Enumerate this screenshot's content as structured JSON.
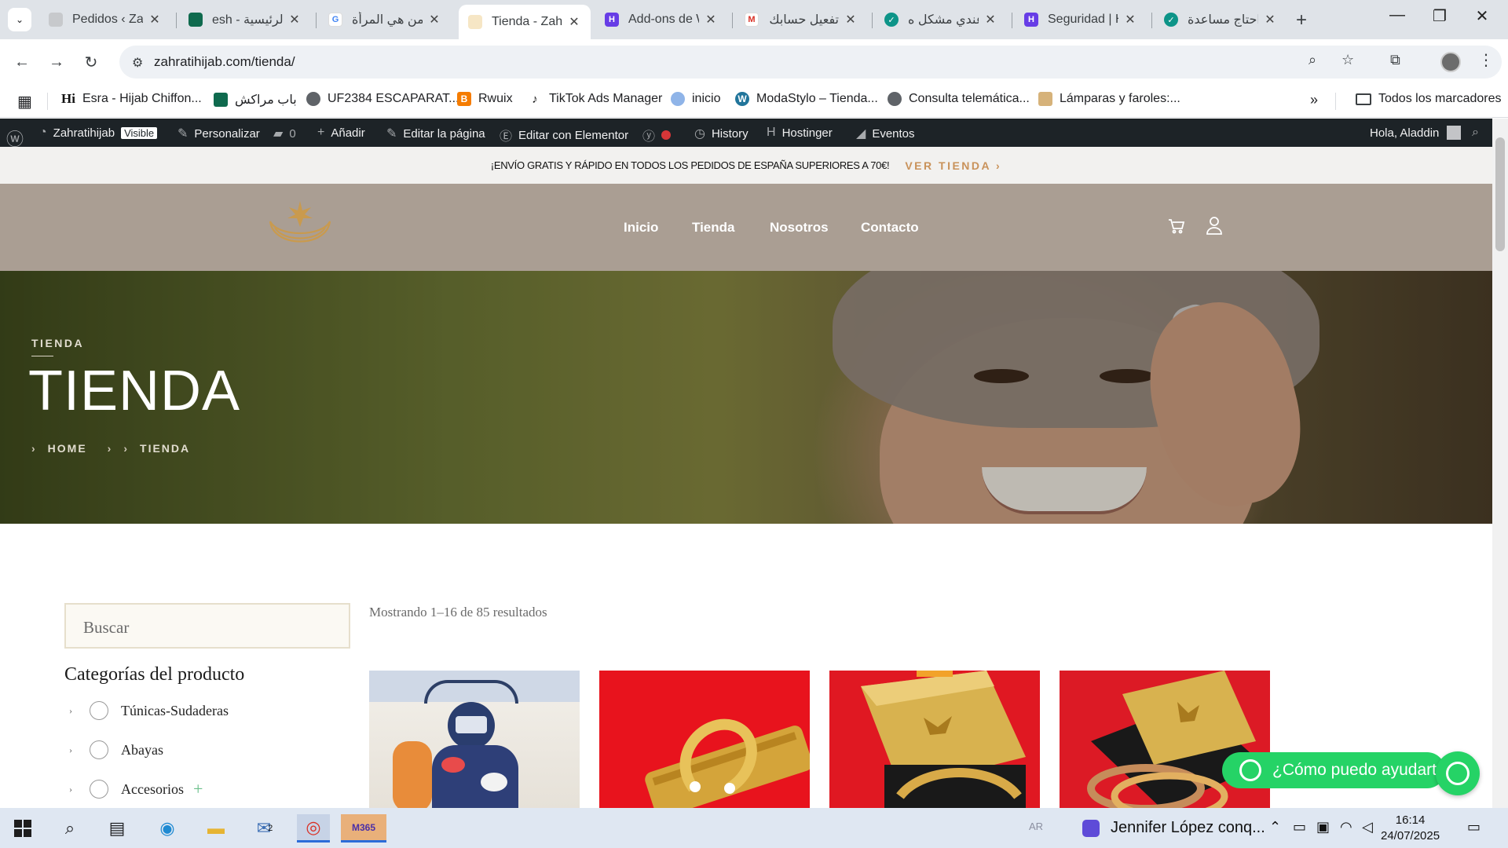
{
  "browser": {
    "tabs": [
      {
        "title": "Pedidos ‹ Zah",
        "icon": "wordpress-icon",
        "active": false
      },
      {
        "title": "esh - الرئيسية",
        "icon": "site-icon",
        "active": false
      },
      {
        "title": "من هي المرأة",
        "icon": "google-icon",
        "active": false
      },
      {
        "title": "Tienda - Zahr",
        "icon": "site-icon",
        "active": true
      },
      {
        "title": "Add-ons de W",
        "icon": "hostinger-icon",
        "active": false
      },
      {
        "title": "تفعيل حسابك",
        "icon": "gmail-icon",
        "active": false
      },
      {
        "title": "عندي مشكل ه",
        "icon": "support-icon",
        "active": false
      },
      {
        "title": "Seguridad | H",
        "icon": "hostinger-icon",
        "active": false
      },
      {
        "title": "احتاج مساعدة",
        "icon": "support-icon",
        "active": false
      }
    ],
    "url": "zahratihijab.com/tienda/",
    "bookmarks": [
      {
        "label": "Esra - Hijab Chiffon...",
        "icon": "hi-icon"
      },
      {
        "label": "باب مراكش",
        "icon": "site-icon"
      },
      {
        "label": "UF2384 ESCAPARAT...",
        "icon": "globe-icon"
      },
      {
        "label": "Rwuix",
        "icon": "blogger-icon"
      },
      {
        "label": "TikTok Ads Manager",
        "icon": "tiktok-icon"
      },
      {
        "label": "inicio",
        "icon": "cloud-icon"
      },
      {
        "label": "ModaStylo – Tienda...",
        "icon": "wordpress-icon"
      },
      {
        "label": "Consulta telemática...",
        "icon": "globe-icon"
      },
      {
        "label": "Lámparas y faroles:...",
        "icon": "lamp-icon"
      }
    ],
    "all_bookmarks_label": "Todos los marcadores"
  },
  "adminbar": {
    "site_name": "Zahratihijab",
    "visible_badge": "Visible",
    "customize": "Personalizar",
    "comments_count": "0",
    "add": "Añadir",
    "edit_page": "Editar la página",
    "edit_elementor": "Editar con Elementor",
    "history": "History",
    "hostinger": "Hostinger",
    "events": "Eventos",
    "greeting": "Hola, Aladdin"
  },
  "site": {
    "promo_text": "¡ENVÍO GRATIS Y RÁPIDO EN TODOS LOS PEDIDOS DE ESPAÑA SUPERIORES A 70€!",
    "promo_link": "VER TIENDA",
    "nav": [
      "Inicio",
      "Tienda",
      "Nosotros",
      "Contacto"
    ],
    "hero": {
      "eyebrow": "TIENDA",
      "title": "TIENDA",
      "breadcrumb": [
        "HOME",
        "TIENDA"
      ]
    },
    "search_placeholder": "Buscar",
    "categories_title": "Categorías del producto",
    "categories": [
      "Túnicas-Sudaderas",
      "Abayas",
      "Accesorios"
    ],
    "results_text": "Mostrando 1–16 de 85 resultados",
    "products": [
      {
        "image": "woman in floral abaya mirror selfie"
      },
      {
        "image": "gold horseshoe bracelet on red"
      },
      {
        "image": "gold gift box with bangle on red"
      },
      {
        "image": "gold gift box with bangles on red"
      }
    ],
    "whatsapp_label": "¿Cómo puedo ayudarte?"
  },
  "taskbar": {
    "lang": "AR",
    "media_title": "Jennifer López conq...",
    "time": "16:14",
    "date": "24/07/2025",
    "mail_badge": "2"
  },
  "colors": {
    "header_bg": "#aa9e93",
    "accent": "#c9925a",
    "whatsapp": "#25d366",
    "adminbar": "#1d2327"
  }
}
